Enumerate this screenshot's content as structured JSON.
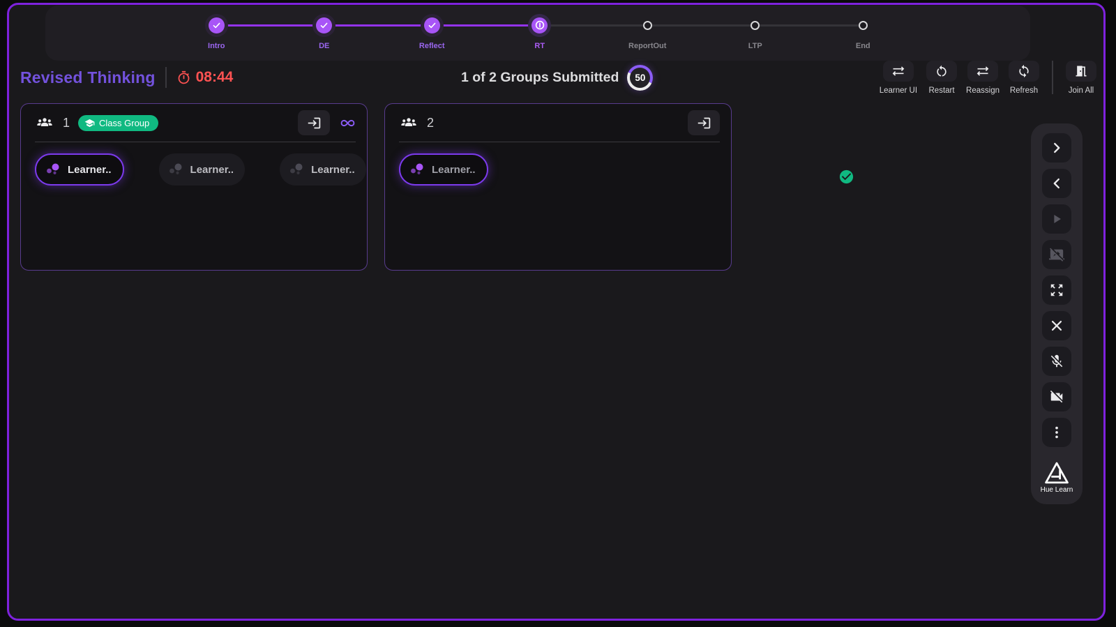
{
  "colors": {
    "accent": "#a855f7",
    "accent_deep": "#7c3aed",
    "frame_border": "#7e22dd",
    "danger": "#ff5252",
    "success": "#10b981"
  },
  "stepper": {
    "steps": [
      {
        "label": "Intro",
        "state": "done"
      },
      {
        "label": "DE",
        "state": "done"
      },
      {
        "label": "Reflect",
        "state": "done"
      },
      {
        "label": "RT",
        "state": "current"
      },
      {
        "label": "ReportOut",
        "state": "todo"
      },
      {
        "label": "LTP",
        "state": "todo"
      },
      {
        "label": "End",
        "state": "todo"
      }
    ]
  },
  "header": {
    "title": "Revised Thinking",
    "timer": "08:44",
    "submitted_text": "1 of 2 Groups Submitted",
    "countdown": "50"
  },
  "toolbar": {
    "buttons": [
      {
        "label": "Learner UI",
        "icon": "swap-arrows"
      },
      {
        "label": "Restart",
        "icon": "restart"
      },
      {
        "label": "Reassign",
        "icon": "swap-arrows"
      },
      {
        "label": "Refresh",
        "icon": "sync"
      },
      {
        "label": "Join All",
        "icon": "door",
        "separated": true
      }
    ]
  },
  "groups": [
    {
      "number": "1",
      "badge": "Class Group",
      "status": "linked",
      "learners": [
        {
          "label": "Learner..",
          "online": true
        },
        {
          "label": "Learner..",
          "online": false
        },
        {
          "label": "Learner..",
          "online": false
        }
      ]
    },
    {
      "number": "2",
      "badge": null,
      "status": "submitted",
      "learners": [
        {
          "label": "Learner..",
          "online": true,
          "muted": true
        }
      ]
    }
  ],
  "sidebar": {
    "logo_text": "Hue Learn",
    "buttons": [
      {
        "name": "panel-expand",
        "icon": "chevron-right",
        "enabled": true
      },
      {
        "name": "panel-collapse",
        "icon": "chevron-left",
        "enabled": true
      },
      {
        "name": "play",
        "icon": "play",
        "enabled": false
      },
      {
        "name": "stop-screen-share",
        "icon": "screenshare-off",
        "enabled": false
      },
      {
        "name": "fullscreen",
        "icon": "expand",
        "enabled": true
      },
      {
        "name": "close",
        "icon": "close",
        "enabled": true
      },
      {
        "name": "mic-off",
        "icon": "mic-off",
        "enabled": true
      },
      {
        "name": "camera-off",
        "icon": "camera-off",
        "enabled": true
      },
      {
        "name": "more-options",
        "icon": "more-vert",
        "enabled": true
      }
    ]
  }
}
